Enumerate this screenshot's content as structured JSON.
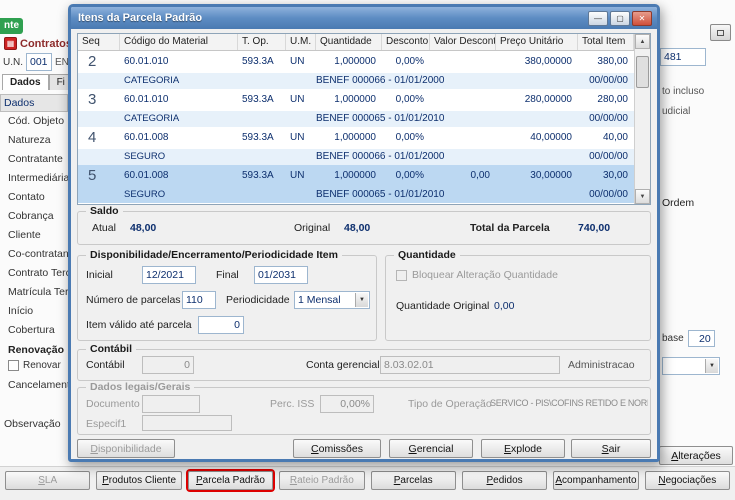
{
  "app": {
    "corner_tab": "nte",
    "title": "Contratos"
  },
  "icons": {
    "minimize": "—",
    "maximize": "▢",
    "close": "✕",
    "scroll_up": "▲",
    "scroll_down": "▼",
    "dropdown": "▼"
  },
  "left_panel": {
    "un_label": "U.N.",
    "un_value": "001",
    "un_fragment": "EN",
    "tab_dados": "Dados",
    "tab_fi": "Fi",
    "items": [
      "Dados",
      "Cód. Objeto",
      "Natureza",
      "Contratante",
      "Intermediária",
      "Contato",
      "Cobrança",
      "Cliente",
      "Co-contratante",
      "Contrato Terceiro",
      "Matrícula Terceiro",
      "Início",
      "Cobertura"
    ],
    "renovacao_header": "Renovação",
    "renovar_label": "Renovar",
    "cancelamento": "Cancelamento",
    "observacao": "Observação"
  },
  "right_panel": {
    "value_481": "481",
    "fragment_incluso": "to incluso",
    "fragment_judicial": "udicial",
    "ordem_label": "Ordem",
    "base_label": "base",
    "base_value": "20",
    "alteracoes_button": "Alterações"
  },
  "bottom_bar": {
    "sla": "SLA",
    "produtos_cliente": "Produtos Cliente",
    "parcela_padrao": "Parcela Padrão",
    "rateio_padrao": "Rateio Padrão",
    "parcelas": "Parcelas",
    "pedidos": "Pedidos",
    "acompanhamento": "Acompanhamento",
    "negociacoes": "Negociações"
  },
  "dialog": {
    "title": "Itens da Parcela Padrão",
    "grid": {
      "columns": [
        "Seq",
        "Código do Material",
        "T. Op.",
        "U.M.",
        "Quantidade",
        "Desconto",
        "Valor Desconto",
        "Preço Unitário",
        "Total Item"
      ],
      "rows": [
        {
          "seq": "2",
          "codigo": "60.01.010",
          "t_op": "593.3A",
          "um": "UN",
          "quantidade": "1,000000",
          "desconto": "0,00%",
          "valor_desconto": "",
          "preco_unitario": "380,00000",
          "total_item": "380,00",
          "categoria": "CATEGORIA",
          "beneficiario": "BENEF 000066 - 01/01/2000",
          "data": "00/00/00"
        },
        {
          "seq": "3",
          "codigo": "60.01.010",
          "t_op": "593.3A",
          "um": "UN",
          "quantidade": "1,000000",
          "desconto": "0,00%",
          "valor_desconto": "",
          "preco_unitario": "280,00000",
          "total_item": "280,00",
          "categoria": "CATEGORIA",
          "beneficiario": "BENEF 000065 - 01/01/2010",
          "data": "00/00/00"
        },
        {
          "seq": "4",
          "codigo": "60.01.008",
          "t_op": "593.3A",
          "um": "UN",
          "quantidade": "1,000000",
          "desconto": "0,00%",
          "valor_desconto": "",
          "preco_unitario": "40,00000",
          "total_item": "40,00",
          "categoria": "SEGURO",
          "beneficiario": "BENEF 000066 - 01/01/2000",
          "data": "00/00/00"
        },
        {
          "seq": "5",
          "codigo": "60.01.008",
          "t_op": "593.3A",
          "um": "UN",
          "quantidade": "1,000000",
          "desconto": "0,00%",
          "valor_desconto": "0,00",
          "preco_unitario": "30,00000",
          "total_item": "30,00",
          "categoria": "SEGURO",
          "beneficiario": "BENEF 000065 - 01/01/2010",
          "data": "00/00/00"
        }
      ]
    },
    "saldo": {
      "caption": "Saldo",
      "atual_label": "Atual",
      "atual_value": "48,00",
      "original_label": "Original",
      "original_value": "48,00",
      "total_label": "Total da Parcela",
      "total_value": "740,00"
    },
    "disponibilidade": {
      "caption": "Disponibilidade/Encerramento/Periodicidade Item",
      "inicial_label": "Inicial",
      "inicial_value": "12/2021",
      "final_label": "Final",
      "final_value": "01/2031",
      "num_parcelas_label": "Número de parcelas",
      "num_parcelas_value": "110",
      "periodicidade_label": "Periodicidade",
      "periodicidade_value": "1 Mensal",
      "item_valido_label": "Item válido até parcela",
      "item_valido_value": "0"
    },
    "quantidade": {
      "caption": "Quantidade",
      "bloquear_label": "Bloquear Alteração Quantidade",
      "original_label": "Quantidade Original",
      "original_value": "0,00"
    },
    "contabil": {
      "caption": "Contábil",
      "contabil_label": "Contábil",
      "contabil_value": "0",
      "conta_label": "Conta gerencial",
      "conta_value": "8.03.02.01",
      "conta_desc": "Administracao"
    },
    "dados_legais": {
      "caption": "Dados legais/Gerais",
      "documento_label": "Documento",
      "documento_value": "",
      "perc_iss_label": "Perc. ISS",
      "perc_iss_value": "0,00%",
      "tipo_label": "Tipo de Operação",
      "tipo_value": "SERVICO - PIS\\COFINS RETIDO E NORMAL",
      "especif_label": "Especif1",
      "especif_value": ""
    },
    "buttons": {
      "disponibilidade": "Disponibilidade",
      "comissoes": "Comissões",
      "gerencial": "Gerencial",
      "explode": "Explode",
      "sair": "Sair"
    }
  }
}
